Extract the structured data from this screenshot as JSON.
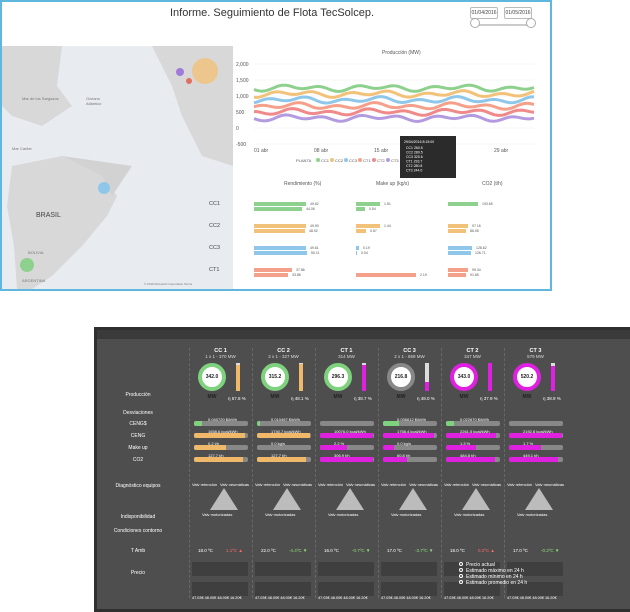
{
  "top": {
    "title": "Informe. Seguimiento de Flota TecSolcep.",
    "date_from": "01/04/2016",
    "date_to": "01/05/2016",
    "map": {
      "labels": [
        "Mar de los Sargazos",
        "Océano Atlántico",
        "BRASIL",
        "Mar Caribe",
        "BOLIVIA",
        "ARGENTINA"
      ],
      "copyright": "© 2016 Microsoft Corporation  Terms"
    },
    "production": {
      "title": "Producción (MW)",
      "y_ticks": [
        "2,000",
        "1,500",
        "1,000",
        "500",
        "0",
        "-500"
      ],
      "x_ticks": [
        "01 abr",
        "08 abr",
        "15 abr",
        "22 abr",
        "29 abr"
      ],
      "legend_label": "PLANTA",
      "legend_items": [
        "CC1",
        "CC2",
        "CC3",
        "CT1",
        "CT2",
        "CT3"
      ],
      "tooltip": {
        "date": "29/04/2016 8:15:00",
        "rows": [
          "CC1 260.5",
          "CC2 280.5",
          "CC3 325.6",
          "CT1 233.7",
          "CT2 280.8",
          "CT3 244.0"
        ]
      }
    },
    "sections": [
      "Rendimiento (%)",
      "Make up (kg/s)",
      "CO2 (t/h)"
    ],
    "plants": [
      "CC1",
      "CC2",
      "CC3",
      "CT1",
      "CT2",
      "CT3"
    ],
    "rend_vals": [
      [
        "49.62",
        "44.06"
      ],
      [
        "49.90",
        "48.92"
      ],
      [
        "49.61",
        "50.11"
      ],
      [
        "37.86",
        "33.86"
      ],
      [
        "37.37",
        "36.69"
      ],
      [
        "30.71",
        "29.45"
      ]
    ],
    "makeup_vals": [
      [
        "1.51",
        "0.54"
      ],
      [
        "1.44",
        "0.57"
      ],
      [
        "0.19",
        "0.04"
      ],
      [
        "",
        "2.19"
      ],
      [
        "",
        "2.75"
      ],
      [
        "",
        "2.11"
      ]
    ],
    "co2_vals": [
      [
        "193.65",
        ""
      ],
      [
        "97.16",
        "86.05"
      ],
      [
        "128.62",
        "126.71"
      ],
      [
        "99.34",
        "91.65"
      ],
      [
        "320.54",
        "285.74"
      ],
      [
        "45.66",
        "41.19"
      ]
    ]
  },
  "bottom": {
    "units": [
      {
        "name": "CC 1",
        "sub": "1 x 1 - 370 MW",
        "prod": "342.0 MW",
        "pct": "η 57.8 %",
        "ceng": "0.040720 $/kWh",
        "deng": "1658.6 kcal/kWh",
        "mu": "0.2 t/h",
        "co2": "127.7 t/h",
        "temp": "18.0 ºC",
        "delta": "1.1ºC ▲",
        "ring": "#7ed27e",
        "bar": "#f0b869"
      },
      {
        "name": "CC 2",
        "sub": "2 x 1 - 327 MW",
        "prod": "315.2 MW",
        "pct": "η 48.1 %",
        "ceng": "0.010467 $/kWh",
        "deng": "1740.7 kcal/kWh",
        "mu": "0.0 kg/s",
        "co2": "127.7 t/h",
        "temp": "22.0 ºC",
        "delta": "-4.4ºC ▼",
        "ring": "#7ed27e",
        "bar": "#f0b869"
      },
      {
        "name": "CT 1",
        "sub": "314 MW",
        "prod": "296.3 MW",
        "pct": "η 38.7 %",
        "ceng": "",
        "deng": "10076.0 kcal/kWh",
        "mu": "2.2 %",
        "co2": "306.9 t/h",
        "temp": "16.0 ºC",
        "delta": "-0.7ºC ▼",
        "ring": "#7ed27e",
        "bar": "#e020e0"
      },
      {
        "name": "CC 3",
        "sub": "2 x 1 - 659 MW",
        "prod": "216.8 MW",
        "pct": "η 48.0 %",
        "ceng": "0.036612 $/kWh",
        "deng": "1758.4 kcal/kWh",
        "mu": "0.0 kg/s",
        "co2": "60.8 t/h",
        "temp": "17.0 ºC",
        "delta": "-3.7ºC ▼",
        "ring": "#888888",
        "bar": "#e020e0"
      },
      {
        "name": "CT 2",
        "sub": "347 MW",
        "prod": "343.0 MW",
        "pct": "η 37.9 %",
        "ceng": "0.022670 $/kWh",
        "deng": "2261.5 kcal/kWh",
        "mu": "1.3 %",
        "co2": "484.8 t/h",
        "temp": "18.0 ºC",
        "delta": "0.2ºC ▲",
        "ring": "#e020e0",
        "bar": "#e020e0"
      },
      {
        "name": "CT 3",
        "sub": "579 MW",
        "prod": "520.2 MW",
        "pct": "η 38.9 %",
        "ceng": "",
        "deng": "2192.8 kcal/kWh",
        "mu": "1.7 %",
        "co2": "449.1 t/h",
        "temp": "17.0 ºC",
        "delta": "-0.2ºC ▼",
        "ring": "#e020e0",
        "bar": "#e020e0"
      }
    ],
    "row_labels": [
      "Producción",
      "Desviaciones",
      "CENG$",
      "CENG",
      "Make up",
      "CO2",
      "Diagnóstico equipos",
      "Indisponibilidad",
      "Condiciones contorno",
      "T Amb",
      "Precio"
    ],
    "diag": {
      "left": "Valv retención",
      "right": "Valv neumáticas",
      "bottom": "Valv motorizadas"
    },
    "price_vals": [
      "47.03€",
      "48.00€",
      "48.00€",
      "16.20€"
    ],
    "legend": [
      "Precio actual",
      "Estimado máximo en 24 h",
      "Estimado mínimo en 24 h",
      "Estimado promedio en 24 h"
    ]
  }
}
